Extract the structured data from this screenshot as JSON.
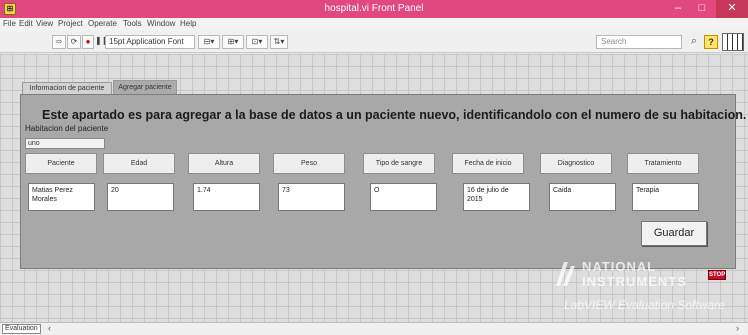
{
  "window": {
    "title": "hospital.vi Front Panel",
    "controls": {
      "minimize": "–",
      "maximize": "□",
      "close": "✕"
    }
  },
  "menu": [
    "File",
    "Edit",
    "View",
    "Project",
    "Operate",
    "Tools",
    "Window",
    "Help"
  ],
  "toolbar": {
    "font": "15pt Application Font",
    "search_placeholder": "Search",
    "icons": [
      "run-arrow-icon",
      "run-continuously-icon",
      "abort-icon",
      "pause-icon",
      "align-icon",
      "distribute-icon",
      "resize-icon",
      "reorder-icon",
      "search-icon",
      "help-icon",
      "connector-pane-icon"
    ]
  },
  "tabs": [
    {
      "label": "Informacion de paciente",
      "selected": false
    },
    {
      "label": "Agregar paciente",
      "selected": true
    }
  ],
  "form": {
    "heading": "Este apartado es para agregar a la base de datos a un paciente nuevo, identificandolo con el numero de su habitacion.",
    "room_label": "Habitacion del paciente",
    "room_value": "uno",
    "columns": [
      "Paciente",
      "Edad",
      "Altura",
      "Peso",
      "Tipo de sangre",
      "Fecha de inicio",
      "Diagnostico",
      "Tratamiento"
    ],
    "values": [
      "Matias Perez Morales",
      "20",
      "1.74",
      "73",
      "O",
      "16 de julio de 2015",
      "Caida",
      "Terapia"
    ],
    "save_label": "Guardar"
  },
  "watermark": {
    "line1": "NATIONAL",
    "line2": "INSTRUMENTS",
    "line3": "LabVIEW Evaluation Software"
  },
  "stop_label": "STOP",
  "status": {
    "mode": "Evaluation"
  },
  "colors": {
    "titlebar": "#e0487e",
    "panel": "#a8a8a8",
    "grid": "#c7c7c7"
  }
}
